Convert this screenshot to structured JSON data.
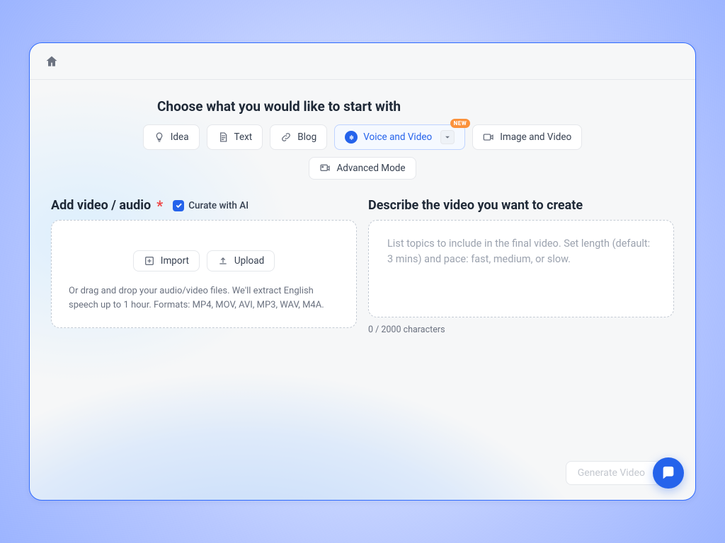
{
  "header": {
    "choose_title": "Choose what you would like to start with"
  },
  "chips": {
    "idea": "Idea",
    "text": "Text",
    "blog": "Blog",
    "voice_video": "Voice and Video",
    "voice_video_badge": "NEW",
    "image_video": "Image and Video",
    "advanced": "Advanced Mode"
  },
  "left": {
    "title": "Add video / audio",
    "curate_label": "Curate with AI",
    "import_label": "Import",
    "upload_label": "Upload",
    "help": "Or drag and drop your audio/video files. We'll extract English speech up to 1 hour. Formats: MP4, MOV, AVI, MP3, WAV, M4A."
  },
  "right": {
    "title": "Describe the video you want to create",
    "placeholder": "List topics to include in the final video. Set length (default: 3 mins) and pace: fast, medium, or slow.",
    "char_count": "0 / 2000 characters"
  },
  "footer": {
    "generate_label": "Generate Video"
  }
}
